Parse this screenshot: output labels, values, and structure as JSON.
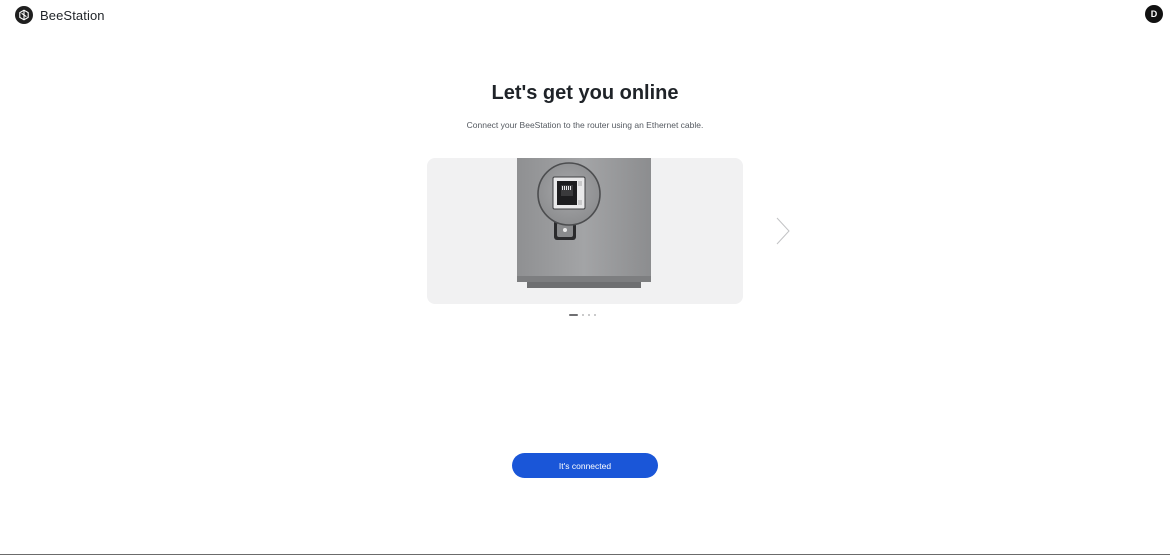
{
  "header": {
    "app_name": "BeeStation",
    "logo_icon": "beestation-logo-icon",
    "avatar_initial": "D"
  },
  "main": {
    "title": "Let's get you online",
    "subtitle": "Connect your BeeStation to the router using an Ethernet cable.",
    "carousel": {
      "slide_count": 4,
      "active_index": 0,
      "slide_image": "beestation-ethernet-port-illustration",
      "next_icon": "chevron-right-icon"
    },
    "primary_button_label": "It's connected"
  },
  "colors": {
    "accent": "#1a56d8",
    "text": "#1f2328",
    "muted_text": "#555a61",
    "panel_bg": "#f1f1f2"
  }
}
